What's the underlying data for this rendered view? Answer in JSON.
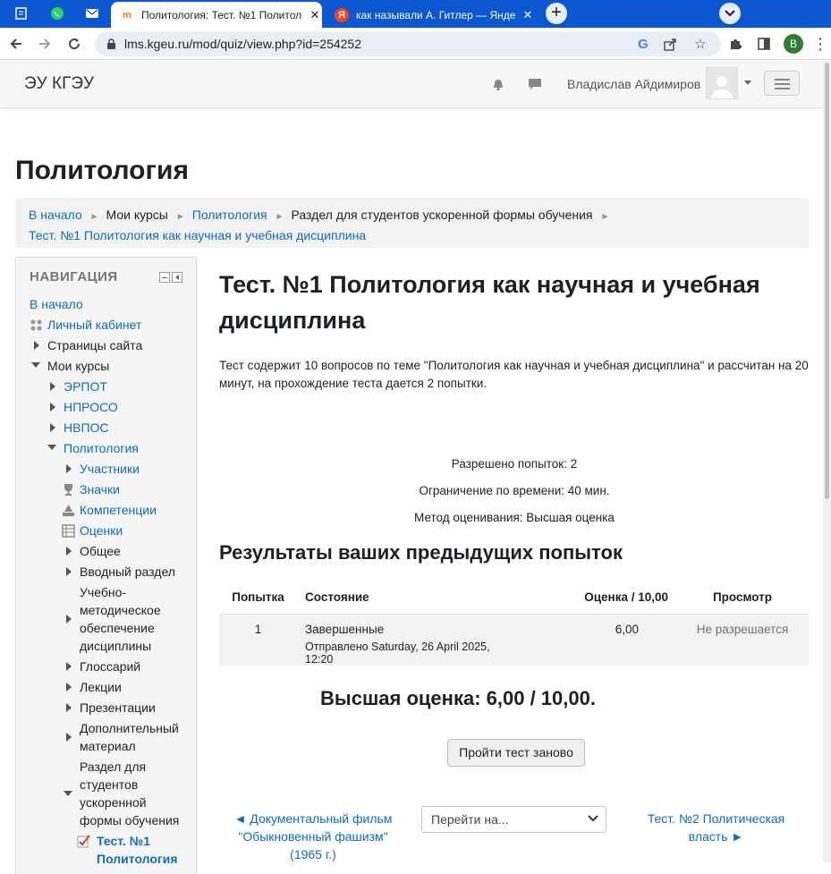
{
  "browser": {
    "tabs": [
      {
        "title": "Политология: Тест. №1 Политолог",
        "active": true
      },
      {
        "title": "как называли А. Гитлер — Яндекс",
        "active": false
      }
    ],
    "url": "lms.kgeu.ru/mod/quiz/view.php?id=254252",
    "profile_initial": "B"
  },
  "header": {
    "brand": "ЭУ КГЭУ",
    "username": "Владислав Айдимиров"
  },
  "page": {
    "title": "Политология"
  },
  "breadcrumb": {
    "items": [
      "В начало",
      "Мои курсы",
      "Политология",
      "Раздел для студентов ускоренной формы обучения",
      "Тест. №1 Политология как научная и учебная дисциплина"
    ]
  },
  "nav": {
    "heading": "НАВИГАЦИЯ",
    "items": [
      "В начало",
      "Личный кабинет",
      "Страницы сайта",
      "Мои курсы",
      "ЭРПОТ",
      "НПРОСО",
      "НВПОС",
      "Политология",
      "Участники",
      "Значки",
      "Компетенции",
      "Оценки",
      "Общее",
      "Вводный раздел",
      "Учебно-",
      "методическое",
      "обеспечение",
      "дисциплины",
      "Глоссарий",
      "Лекции",
      "Презентации",
      "Дополнительный",
      "материал",
      "Раздел для",
      "студентов",
      "ускоренной",
      "формы обучения",
      "Тест. №1",
      "Политология"
    ]
  },
  "quiz": {
    "title": "Тест. №1 Политология как научная и учебная дисциплина",
    "description": "Тест содержит 10 вопросов по теме \"Политология как научная и учебная дисциплина\" и рассчитан на 20 минут, на прохождение теста дается 2 попытки.",
    "attempts_allowed": "Разрешено попыток: 2",
    "time_limit": "Ограничение по времени: 40 мин.",
    "grading_method": "Метод оценивания: Высшая оценка",
    "results_heading": "Результаты ваших предыдущих попыток",
    "table": {
      "headers": [
        "Попытка",
        "Состояние",
        "Оценка / 10,00",
        "Просмотр"
      ],
      "rows": [
        {
          "attempt": "1",
          "state": "Завершенные",
          "submitted": "Отправлено Saturday, 26 April 2025, 12:20",
          "grade": "6,00",
          "review": "Не разрешается"
        }
      ]
    },
    "best_grade": "Высшая оценка: 6,00 / 10,00.",
    "retry_label": "Пройти тест заново"
  },
  "footer_nav": {
    "prev": "◄ Документальный фильм \"Обыкновенный фашизм\" (1965 г.)",
    "jump_placeholder": "Перейти на...",
    "next": "Тест. №2 Политическая власть ►"
  },
  "colors": {
    "link": "#0f6cbf",
    "chrome_blue": "#0b57d0"
  }
}
